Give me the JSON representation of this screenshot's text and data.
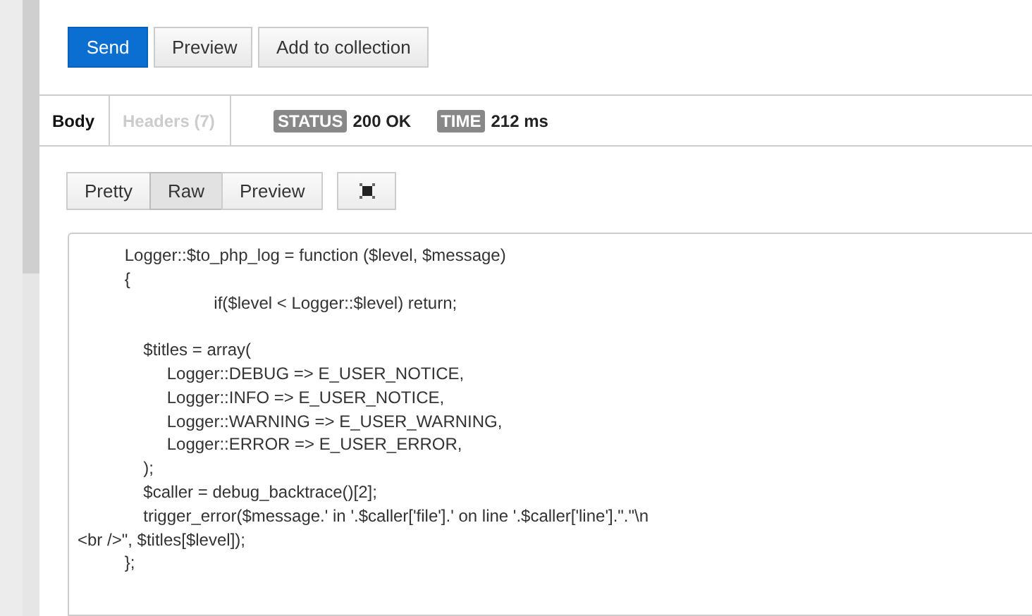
{
  "actions": [
    {
      "label": "Send",
      "kind": "primary"
    },
    {
      "label": "Preview",
      "kind": "default"
    },
    {
      "label": "Add to collection",
      "kind": "default"
    }
  ],
  "response_tabs": [
    {
      "label": "Body",
      "selected": true
    },
    {
      "label": "Headers (7)",
      "selected": false
    }
  ],
  "status": {
    "label": "STATUS",
    "value": "200 OK"
  },
  "time": {
    "label": "TIME",
    "value": "212 ms"
  },
  "view_modes": [
    {
      "label": "Pretty",
      "selected": false
    },
    {
      "label": "Raw",
      "selected": true
    },
    {
      "label": "Preview",
      "selected": false
    }
  ],
  "code_lines": [
    {
      "kind": "text",
      "text": "          Logger::$to_php_log = function ($level, $message)"
    },
    {
      "kind": "text",
      "text": "          {"
    },
    {
      "kind": "text",
      "text": "                             if($level < Logger::$level) return;"
    },
    {
      "kind": "blank"
    },
    {
      "kind": "text",
      "text": "              $titles = array("
    },
    {
      "kind": "text",
      "text": "                   Logger::DEBUG => E_USER_NOTICE,"
    },
    {
      "kind": "text",
      "text": "                   Logger::INFO => E_USER_NOTICE,"
    },
    {
      "kind": "text",
      "text": "                   Logger::WARNING => E_USER_WARNING,"
    },
    {
      "kind": "text",
      "text": "                   Logger::ERROR => E_USER_ERROR,"
    },
    {
      "kind": "text",
      "text": "              );"
    },
    {
      "kind": "text",
      "text": "              $caller = debug_backtrace()[2];"
    },
    {
      "kind": "text",
      "text": "              trigger_error($message.' in '.$caller['file'].' on line '.$caller['line'].\".\"\\n"
    },
    {
      "kind": "text",
      "text": "<br />\", $titles[$level]);"
    },
    {
      "kind": "text",
      "text": "          };"
    }
  ]
}
